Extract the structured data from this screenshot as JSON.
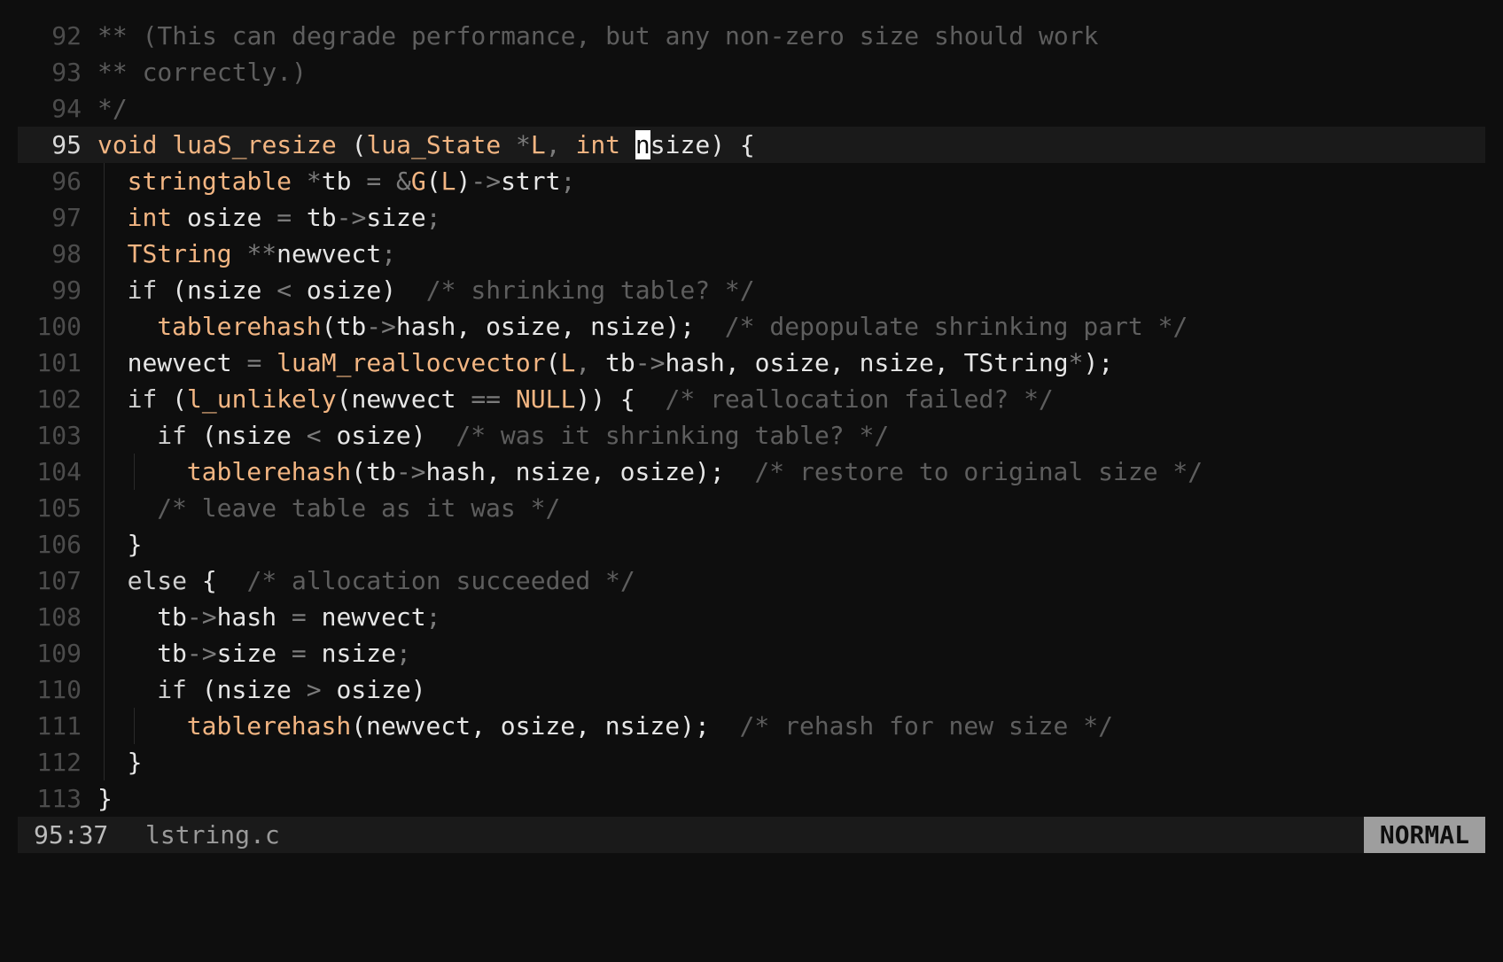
{
  "editor": {
    "file_name": "lstring.c",
    "cursor_position": "95:37",
    "mode": "NORMAL",
    "current_line": 95,
    "lines": [
      {
        "n": "92",
        "indent": 0,
        "guides": [],
        "tokens": [
          [
            "cm",
            "** (This can degrade performance, but any non-zero size should work"
          ]
        ]
      },
      {
        "n": "93",
        "indent": 0,
        "guides": [],
        "tokens": [
          [
            "cm",
            "** correctly.)"
          ]
        ]
      },
      {
        "n": "94",
        "indent": 0,
        "guides": [],
        "tokens": [
          [
            "cm",
            "*/"
          ]
        ]
      },
      {
        "n": "95",
        "indent": 0,
        "guides": [],
        "current": true,
        "tokens": [
          [
            "ty",
            "void "
          ],
          [
            "fn",
            "luaS_resize "
          ],
          [
            "id",
            "("
          ],
          [
            "ty",
            "lua_State "
          ],
          [
            "op",
            "*"
          ],
          [
            "ty",
            "L"
          ],
          [
            "op",
            ", "
          ],
          [
            "ty",
            "int "
          ],
          [
            "cursor",
            "n"
          ],
          [
            "id",
            "size) {"
          ]
        ]
      },
      {
        "n": "96",
        "indent": 1,
        "guides": [
          0
        ],
        "tokens": [
          [
            "ty",
            "stringtable "
          ],
          [
            "op",
            "*"
          ],
          [
            "id",
            "tb "
          ],
          [
            "op",
            "= &"
          ],
          [
            "ty",
            "G"
          ],
          [
            "id",
            "("
          ],
          [
            "ty",
            "L"
          ],
          [
            "id",
            ")"
          ],
          [
            "op",
            "->"
          ],
          [
            "id",
            "strt"
          ],
          [
            "op",
            ";"
          ]
        ]
      },
      {
        "n": "97",
        "indent": 1,
        "guides": [
          0
        ],
        "tokens": [
          [
            "ty",
            "int "
          ],
          [
            "id",
            "osize "
          ],
          [
            "op",
            "= "
          ],
          [
            "id",
            "tb"
          ],
          [
            "op",
            "->"
          ],
          [
            "id",
            "size"
          ],
          [
            "op",
            ";"
          ]
        ]
      },
      {
        "n": "98",
        "indent": 1,
        "guides": [
          0
        ],
        "tokens": [
          [
            "ty",
            "TString "
          ],
          [
            "op",
            "**"
          ],
          [
            "id",
            "newvect"
          ],
          [
            "op",
            ";"
          ]
        ]
      },
      {
        "n": "99",
        "indent": 1,
        "guides": [
          0
        ],
        "tokens": [
          [
            "kw",
            "if "
          ],
          [
            "id",
            "(nsize "
          ],
          [
            "op",
            "< "
          ],
          [
            "id",
            "osize)  "
          ],
          [
            "cm",
            "/* shrinking table? */"
          ]
        ]
      },
      {
        "n": "100",
        "indent": 2,
        "guides": [
          0
        ],
        "tokens": [
          [
            "fn",
            "tablerehash"
          ],
          [
            "id",
            "(tb"
          ],
          [
            "op",
            "->"
          ],
          [
            "id",
            "hash, osize, nsize);  "
          ],
          [
            "cm",
            "/* depopulate shrinking part */"
          ]
        ]
      },
      {
        "n": "101",
        "indent": 1,
        "guides": [
          0
        ],
        "tokens": [
          [
            "id",
            "newvect "
          ],
          [
            "op",
            "= "
          ],
          [
            "fn",
            "luaM_reallocvector"
          ],
          [
            "id",
            "("
          ],
          [
            "ty",
            "L"
          ],
          [
            "op",
            ", "
          ],
          [
            "id",
            "tb"
          ],
          [
            "op",
            "->"
          ],
          [
            "id",
            "hash, osize, nsize, TString"
          ],
          [
            "op",
            "*"
          ],
          [
            "id",
            ");"
          ]
        ]
      },
      {
        "n": "102",
        "indent": 1,
        "guides": [
          0
        ],
        "tokens": [
          [
            "kw",
            "if "
          ],
          [
            "id",
            "("
          ],
          [
            "fn",
            "l_unlikely"
          ],
          [
            "id",
            "(newvect "
          ],
          [
            "op",
            "== "
          ],
          [
            "ty",
            "NULL"
          ],
          [
            "id",
            ")) {  "
          ],
          [
            "cm",
            "/* reallocation failed? */"
          ]
        ]
      },
      {
        "n": "103",
        "indent": 2,
        "guides": [
          0
        ],
        "tokens": [
          [
            "kw",
            "if "
          ],
          [
            "id",
            "(nsize "
          ],
          [
            "op",
            "< "
          ],
          [
            "id",
            "osize)  "
          ],
          [
            "cm",
            "/* was it shrinking table? */"
          ]
        ]
      },
      {
        "n": "104",
        "indent": 3,
        "guides": [
          0,
          2
        ],
        "tokens": [
          [
            "fn",
            "tablerehash"
          ],
          [
            "id",
            "(tb"
          ],
          [
            "op",
            "->"
          ],
          [
            "id",
            "hash, nsize, osize);  "
          ],
          [
            "cm",
            "/* restore to original size */"
          ]
        ]
      },
      {
        "n": "105",
        "indent": 2,
        "guides": [
          0
        ],
        "tokens": [
          [
            "cm",
            "/* leave table as it was */"
          ]
        ]
      },
      {
        "n": "106",
        "indent": 1,
        "guides": [
          0
        ],
        "tokens": [
          [
            "id",
            "}"
          ]
        ]
      },
      {
        "n": "107",
        "indent": 1,
        "guides": [
          0
        ],
        "tokens": [
          [
            "kw",
            "else "
          ],
          [
            "id",
            "{  "
          ],
          [
            "cm",
            "/* allocation succeeded */"
          ]
        ]
      },
      {
        "n": "108",
        "indent": 2,
        "guides": [
          0
        ],
        "tokens": [
          [
            "id",
            "tb"
          ],
          [
            "op",
            "->"
          ],
          [
            "id",
            "hash "
          ],
          [
            "op",
            "= "
          ],
          [
            "id",
            "newvect"
          ],
          [
            "op",
            ";"
          ]
        ]
      },
      {
        "n": "109",
        "indent": 2,
        "guides": [
          0
        ],
        "tokens": [
          [
            "id",
            "tb"
          ],
          [
            "op",
            "->"
          ],
          [
            "id",
            "size "
          ],
          [
            "op",
            "= "
          ],
          [
            "id",
            "nsize"
          ],
          [
            "op",
            ";"
          ]
        ]
      },
      {
        "n": "110",
        "indent": 2,
        "guides": [
          0
        ],
        "tokens": [
          [
            "kw",
            "if "
          ],
          [
            "id",
            "(nsize "
          ],
          [
            "op",
            "> "
          ],
          [
            "id",
            "osize)"
          ]
        ]
      },
      {
        "n": "111",
        "indent": 3,
        "guides": [
          0,
          2
        ],
        "tokens": [
          [
            "fn",
            "tablerehash"
          ],
          [
            "id",
            "(newvect, osize, nsize);  "
          ],
          [
            "cm",
            "/* rehash for new size */"
          ]
        ]
      },
      {
        "n": "112",
        "indent": 1,
        "guides": [
          0
        ],
        "tokens": [
          [
            "id",
            "}"
          ]
        ]
      },
      {
        "n": "113",
        "indent": 0,
        "guides": [],
        "tokens": [
          [
            "id",
            "}"
          ]
        ]
      }
    ]
  }
}
